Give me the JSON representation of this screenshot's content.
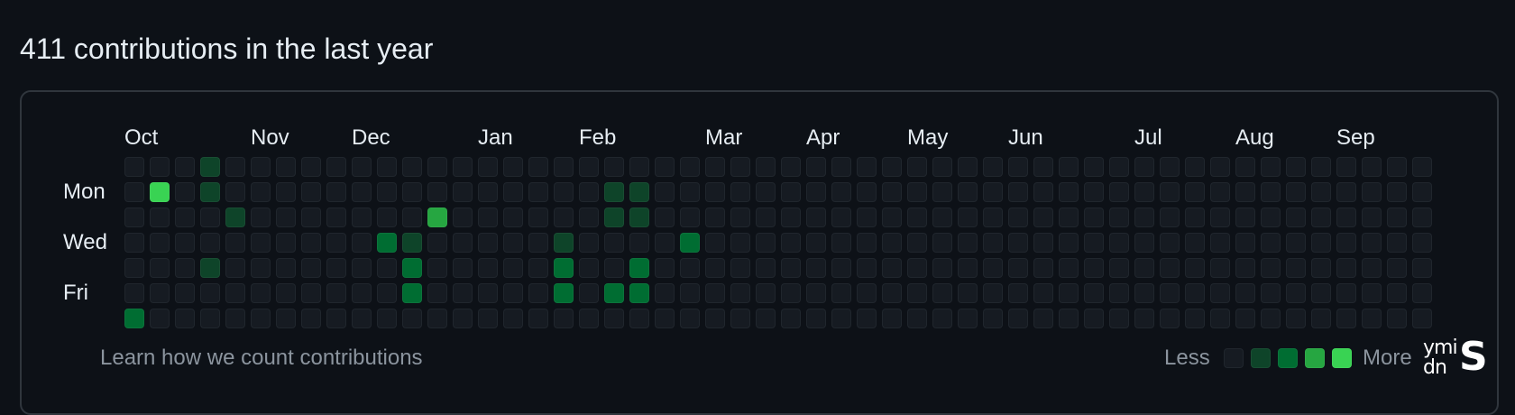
{
  "heading": "411 contributions in the last year",
  "months": [
    {
      "label": "Oct",
      "week": 0
    },
    {
      "label": "Nov",
      "week": 5
    },
    {
      "label": "Dec",
      "week": 9
    },
    {
      "label": "Jan",
      "week": 14
    },
    {
      "label": "Feb",
      "week": 18
    },
    {
      "label": "Mar",
      "week": 23
    },
    {
      "label": "Apr",
      "week": 27
    },
    {
      "label": "May",
      "week": 31
    },
    {
      "label": "Jun",
      "week": 35
    },
    {
      "label": "Jul",
      "week": 40
    },
    {
      "label": "Aug",
      "week": 44
    },
    {
      "label": "Sep",
      "week": 48
    }
  ],
  "day_labels": [
    {
      "label": "Mon",
      "row": 1
    },
    {
      "label": "Wed",
      "row": 3
    },
    {
      "label": "Fri",
      "row": 5
    }
  ],
  "colors": {
    "level0": "#161b22",
    "level1": "#0e4429",
    "level2": "#006d32",
    "level3": "#26a641",
    "level4": "#39d353"
  },
  "weeks": [
    "0000002",
    "0400000",
    "0000000",
    "1100100",
    "0010000",
    "0000000",
    "0000000",
    "0000000",
    "0000000",
    "0000000",
    "0002000",
    "0001220",
    "0030000",
    "0000000",
    "0000000",
    "0000000",
    "0000000",
    "0001220",
    "0000000",
    "0110020",
    "0110220",
    "0000000",
    "0002000",
    "0000000",
    "0000000",
    "0000000",
    "0000000",
    "0000000",
    "0000000",
    "0000000",
    "0000000",
    "0000000",
    "0000000",
    "0000000",
    "0000000",
    "0000000",
    "0000000",
    "0000000",
    "0000000",
    "0000000",
    "0000000",
    "0000000",
    "0000000",
    "0000000",
    "0000000",
    "0000000",
    "0000000",
    "0000000",
    "0000000",
    "0000000",
    "0000000",
    "0000000"
  ],
  "footer": {
    "learn_link": "Learn how we count contributions",
    "less": "Less",
    "more": "More"
  },
  "legend_levels": [
    0,
    1,
    2,
    3,
    4
  ],
  "logo": {
    "part_a": "ymi",
    "part_b": "dn",
    "part_c": "S"
  }
}
